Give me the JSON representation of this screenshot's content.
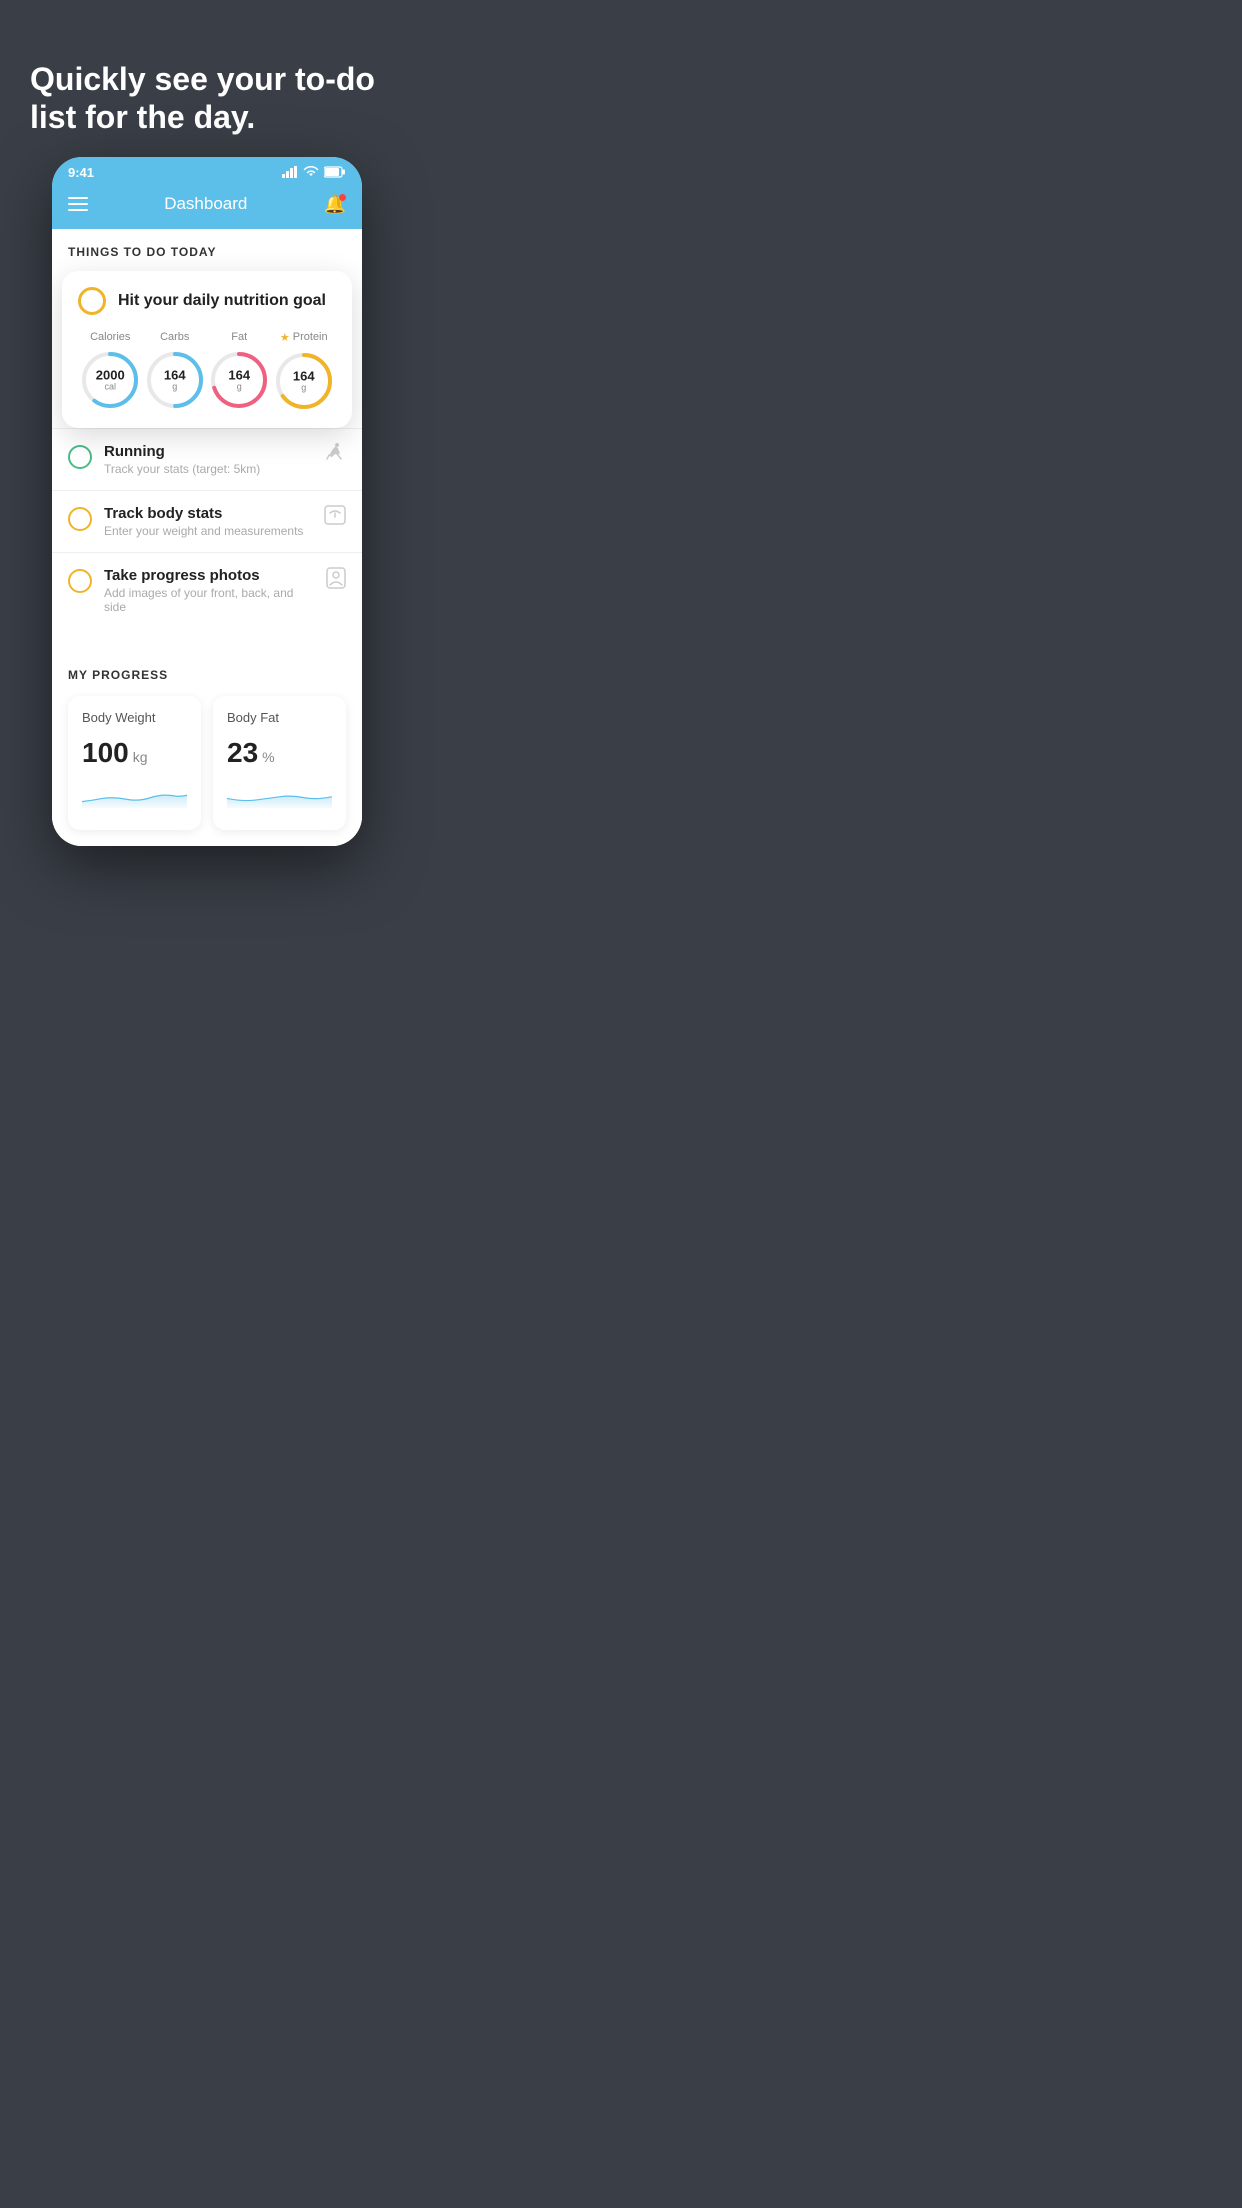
{
  "hero": {
    "title": "Quickly see your to-do list for the day."
  },
  "status_bar": {
    "time": "9:41"
  },
  "nav": {
    "title": "Dashboard"
  },
  "things_section": {
    "title": "THINGS TO DO TODAY"
  },
  "nutrition_card": {
    "title": "Hit your daily nutrition goal",
    "items": [
      {
        "label": "Calories",
        "value": "2000",
        "unit": "cal",
        "color": "#5bbfea",
        "pct": 60
      },
      {
        "label": "Carbs",
        "value": "164",
        "unit": "g",
        "color": "#5bbfea",
        "pct": 50
      },
      {
        "label": "Fat",
        "value": "164",
        "unit": "g",
        "color": "#f06080",
        "pct": 70
      },
      {
        "label": "Protein",
        "value": "164",
        "unit": "g",
        "color": "#f0b429",
        "pct": 65,
        "starred": true
      }
    ]
  },
  "todo_items": [
    {
      "name": "Running",
      "sub": "Track your stats (target: 5km)",
      "circle_color": "green",
      "icon": "👟"
    },
    {
      "name": "Track body stats",
      "sub": "Enter your weight and measurements",
      "circle_color": "yellow",
      "icon": "⚖"
    },
    {
      "name": "Take progress photos",
      "sub": "Add images of your front, back, and side",
      "circle_color": "yellow",
      "icon": "👤"
    }
  ],
  "progress_section": {
    "title": "MY PROGRESS",
    "cards": [
      {
        "title": "Body Weight",
        "value": "100",
        "unit": "kg"
      },
      {
        "title": "Body Fat",
        "value": "23",
        "unit": "%"
      }
    ]
  }
}
